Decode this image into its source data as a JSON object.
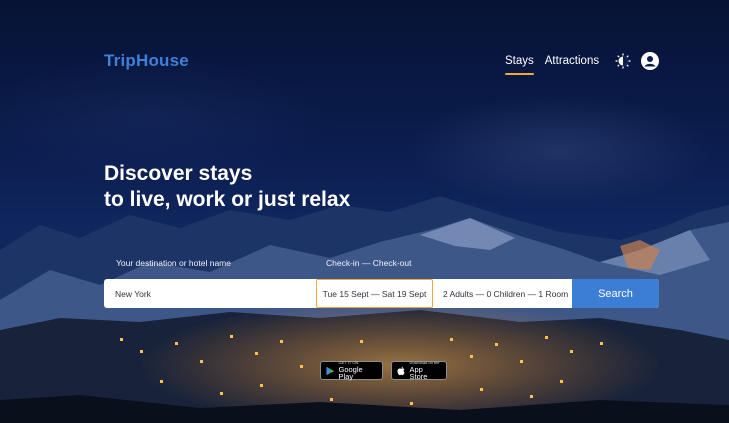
{
  "header": {
    "logo": "TripHouse",
    "nav": [
      {
        "label": "Stays",
        "active": true
      },
      {
        "label": "Attractions",
        "active": false
      }
    ],
    "icons": [
      "theme-toggle-icon",
      "account-icon"
    ]
  },
  "hero": {
    "headline_line1": "Discover stays",
    "headline_line2": "to live, work or just relax"
  },
  "search": {
    "destination_label": "Your destination or hotel name",
    "destination_value": "New York",
    "dates_label": "Check-in — Check-out",
    "dates_value": "Tue 15 Sept — Sat 19 Sept",
    "guests_value": "2 Adults — 0 Children — 1 Room",
    "button_label": "Search"
  },
  "stores": {
    "google_small": "GET IT ON",
    "google_big": "Google Play",
    "apple_small": "Download on the",
    "apple_big": "App Store"
  },
  "colors": {
    "brand": "#3f80d8",
    "accent": "#f2a83b",
    "button": "#3c7ed6"
  }
}
